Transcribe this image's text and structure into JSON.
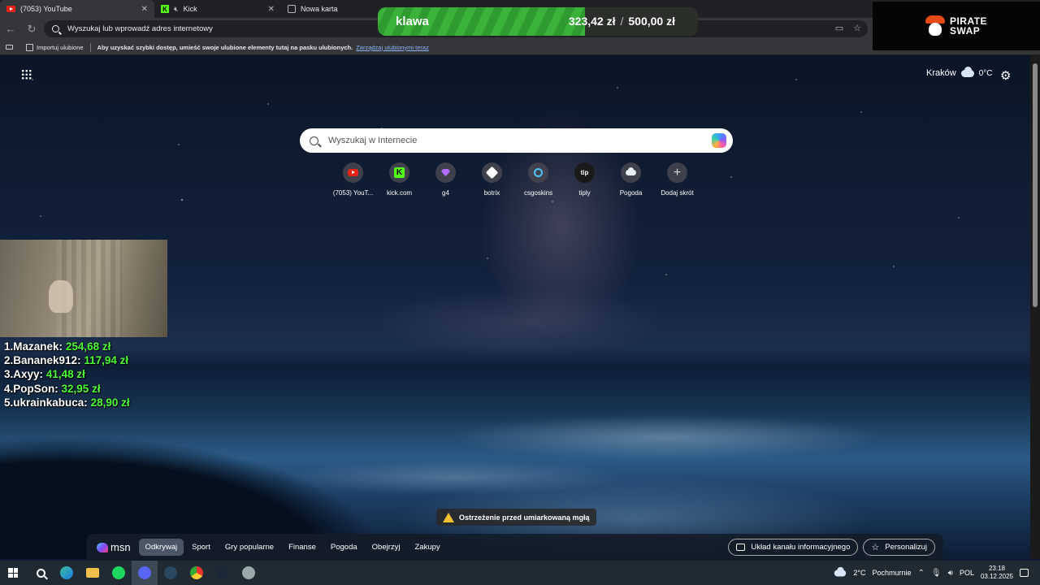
{
  "browser": {
    "tabs": [
      {
        "label": "(7053) YouTube",
        "favicon": "youtube-icon"
      },
      {
        "label": "Kick",
        "favicon": "kick-icon",
        "muted": true
      },
      {
        "label": "Nowa karta",
        "favicon": "page-icon"
      }
    ],
    "address_placeholder": "Wyszukaj lub wprowadź adres internetowy",
    "favorites": {
      "import_label": "Importuj ulubione",
      "message": "Aby uzyskać szybki dostęp, umieść swoje ulubione elementy tutaj na pasku ulubionych.",
      "manage_link": "Zarządzaj ulubionymi teraz"
    }
  },
  "donation_goal": {
    "name": "klawa",
    "current": "323,42 zł",
    "separator": "/",
    "target": "500,00 zł",
    "progress_fraction": 0.647
  },
  "sponsor": {
    "line1": "PIRATE",
    "line2": "SWAP"
  },
  "newtab": {
    "location": "Kraków",
    "temperature": "0°C",
    "search_placeholder": "Wyszukaj w Internecie",
    "shortcuts": [
      {
        "label": "(7053) YouT...",
        "icon": "youtube-icon"
      },
      {
        "label": "kick.com",
        "icon": "kick-icon"
      },
      {
        "label": "g4",
        "icon": "gem-icon"
      },
      {
        "label": "botrix",
        "icon": "botrix-icon"
      },
      {
        "label": "csgoskins",
        "icon": "csgoskins-icon"
      },
      {
        "label": "tiply",
        "icon": "tip-icon",
        "text": "tip"
      },
      {
        "label": "Pogoda",
        "icon": "cloud-icon"
      },
      {
        "label": "Dodaj skrót",
        "icon": "plus-icon",
        "text": "+"
      }
    ],
    "warning": "Ostrzeżenie przed umiarkowaną mgłą"
  },
  "leaderboard": [
    {
      "rank": "1.",
      "name": "Mazanek:",
      "amount": "254,68 zł"
    },
    {
      "rank": "2.",
      "name": "Bananek912:",
      "amount": "117,94 zł"
    },
    {
      "rank": "3.",
      "name": "Axyy:",
      "amount": "41,48 zł"
    },
    {
      "rank": "4.",
      "name": "PopSon:",
      "amount": "32,95 zł"
    },
    {
      "rank": "5.",
      "name": "ukrainkabuca:",
      "amount": "28,90 zł"
    }
  ],
  "msn": {
    "logo": "msn",
    "nav": [
      "Odkrywaj",
      "Sport",
      "Gry popularne",
      "Finanse",
      "Pogoda",
      "Obejrzyj",
      "Zakupy"
    ],
    "active": "Odkrywaj",
    "layout_button": "Układ kanału informacyjnego",
    "personalize_button": "Personalizuj"
  },
  "taskbar": {
    "weather": "2°C",
    "condition": "Pochmurnie",
    "language": "POL",
    "time": "23:18",
    "date": "03.12.2025"
  },
  "colors": {
    "accent_green": "#4cff3a",
    "kick_green": "#53fc18",
    "youtube_red": "#e62117"
  }
}
